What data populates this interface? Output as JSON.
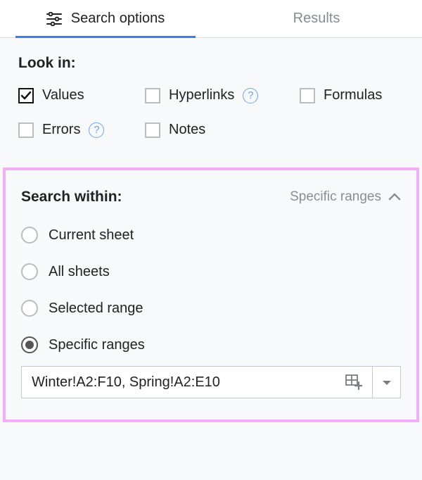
{
  "tabs": {
    "search_options": "Search options",
    "results": "Results"
  },
  "look_in": {
    "title": "Look in:",
    "items": {
      "values": "Values",
      "hyperlinks": "Hyperlinks",
      "formulas": "Formulas",
      "errors": "Errors",
      "notes": "Notes"
    }
  },
  "search_within": {
    "title": "Search within:",
    "summary": "Specific ranges",
    "options": {
      "current_sheet": "Current sheet",
      "all_sheets": "All sheets",
      "selected_range": "Selected range",
      "specific_ranges": "Specific ranges"
    },
    "range_value": "Winter!A2:F10, Spring!A2:E10"
  }
}
